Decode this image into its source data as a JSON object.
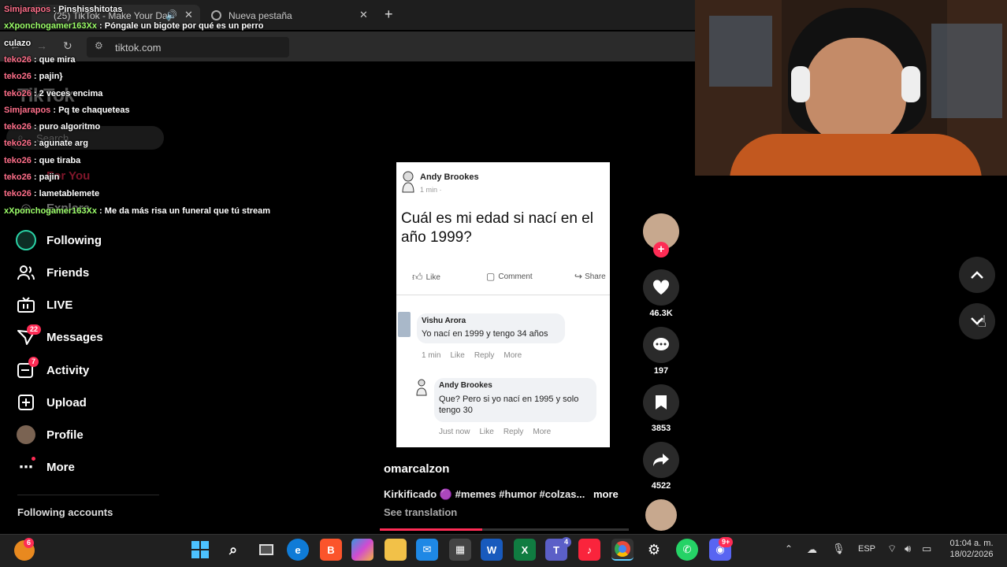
{
  "browser": {
    "tabs": [
      {
        "label": "(25) TikTok - Make Your Day"
      },
      {
        "label": "Nueva pestaña"
      }
    ],
    "url": "tiktok.com"
  },
  "tiktok": {
    "logo": "TikTok",
    "search_placeholder": "Search",
    "nav": [
      {
        "label": "For You"
      },
      {
        "label": "Explore"
      },
      {
        "label": "Following"
      },
      {
        "label": "Friends"
      },
      {
        "label": "LIVE"
      },
      {
        "label": "Messages",
        "badge": "22"
      },
      {
        "label": "Activity",
        "badge": "7"
      },
      {
        "label": "Upload"
      },
      {
        "label": "Profile"
      },
      {
        "label": "More"
      }
    ],
    "following_accounts": "Following accounts"
  },
  "chat": [
    {
      "user": "Simjarapos",
      "msg": "Pinshisshitotas"
    },
    {
      "user": "xXponchogamer163Xx",
      "msg": "Póngale un bigote por qué es un perro"
    },
    {
      "user": "",
      "msg": "culazo"
    },
    {
      "user": "teko26",
      "msg": "que mira"
    },
    {
      "user": "teko26",
      "msg": "pajin}"
    },
    {
      "user": "teko26",
      "msg": "2 veces encima"
    },
    {
      "user": "Simjarapos",
      "msg": "Pq te chaqueteas"
    },
    {
      "user": "teko26",
      "msg": "puro algoritmo"
    },
    {
      "user": "teko26",
      "msg": "agunate arg"
    },
    {
      "user": "teko26",
      "msg": "que tiraba"
    },
    {
      "user": "teko26",
      "msg": "pajin"
    },
    {
      "user": "teko26",
      "msg": "lametablemete"
    },
    {
      "user": "xXponchogamer163Xx",
      "msg": "Me da más risa un funeral que tú stream"
    }
  ],
  "post": {
    "author": "Andy Brookes",
    "time": "1 min ·",
    "text": "Cuál es mi edad si nací en el año 1999?",
    "buttons": [
      "Like",
      "Comment",
      "Share"
    ],
    "comments": [
      {
        "name": "Vishu Arora",
        "text": "Yo nací en 1999 y tengo 34 años",
        "time": "1 min",
        "actions": [
          "Like",
          "Reply",
          "More"
        ]
      },
      {
        "name": "Andy Brookes",
        "text": "Que? Pero si yo nací en 1995 y solo tengo 30",
        "time": "Just now",
        "actions": [
          "Like",
          "Reply",
          "More"
        ]
      }
    ]
  },
  "video": {
    "username": "omarcalzon",
    "caption": "Kirkificado 🟣 #memes #humor #colzas...",
    "more": "more",
    "see_translation": "See translation",
    "likes": "46.3K",
    "comments": "197",
    "saves": "3853",
    "shares": "4522"
  },
  "taskbar": {
    "lang": "ESP",
    "time": "01:04 a. m.",
    "date": "18/02/2026",
    "notif_badge": "6",
    "discord_badge": "9+",
    "teams_badge": "4"
  },
  "colors": {
    "accent": "#fe2c55",
    "bg": "#000000"
  }
}
